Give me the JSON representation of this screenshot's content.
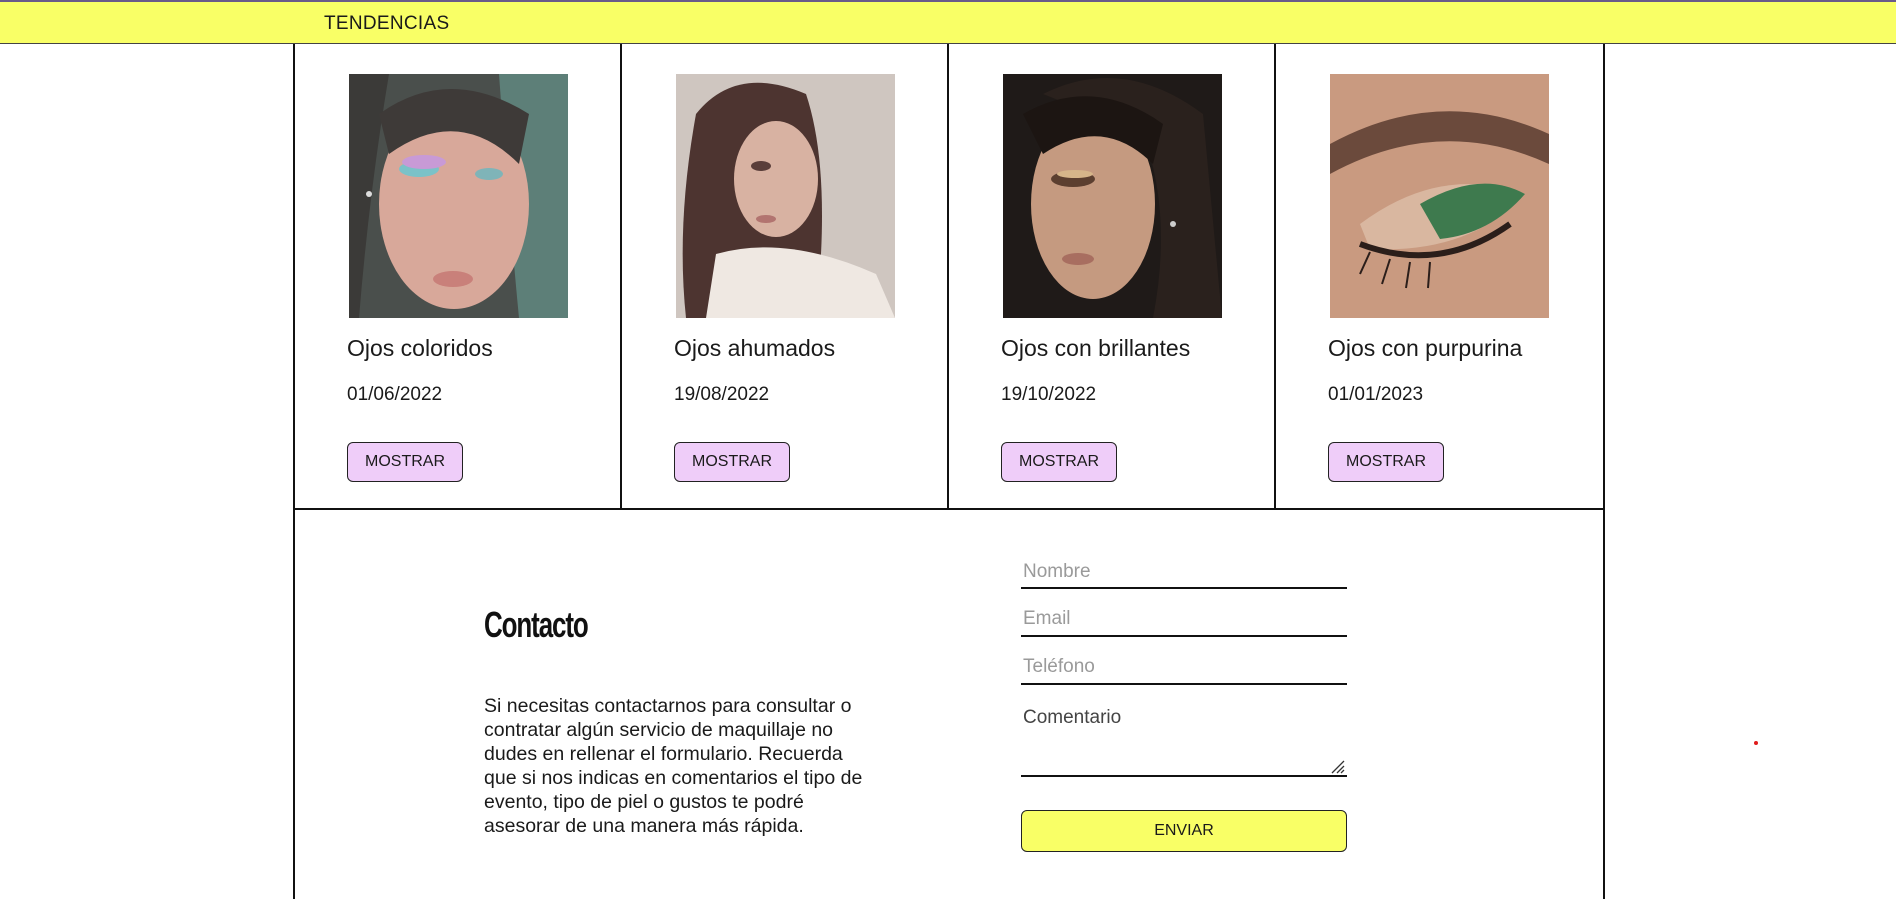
{
  "nav": {
    "label": "TENDENCIAS"
  },
  "cards": [
    {
      "title": "Ojos coloridos",
      "date": "01/06/2022",
      "button": "MOSTRAR"
    },
    {
      "title": "Ojos ahumados",
      "date": "19/08/2022",
      "button": "MOSTRAR"
    },
    {
      "title": "Ojos con brillantes",
      "date": "19/10/2022",
      "button": "MOSTRAR"
    },
    {
      "title": "Ojos con purpurina",
      "date": "01/01/2023",
      "button": "MOSTRAR"
    }
  ],
  "contact": {
    "title": "Contacto",
    "text": "Si necesitas contactarnos para consultar o contratar algún servicio de maquillaje no dudes en rellenar el formulario. Recuerda que si nos indicas en comentarios el tipo de evento, tipo de piel o gustos te podré asesorar de una manera más rápida.",
    "form": {
      "name_placeholder": "Nombre",
      "email_placeholder": "Email",
      "phone_placeholder": "Teléfono",
      "comment_placeholder": "Comentario",
      "submit": "ENVIAR"
    }
  },
  "colors": {
    "topbar": "#f9ff66",
    "button": "#efcdf9",
    "submit": "#f9ff66"
  }
}
